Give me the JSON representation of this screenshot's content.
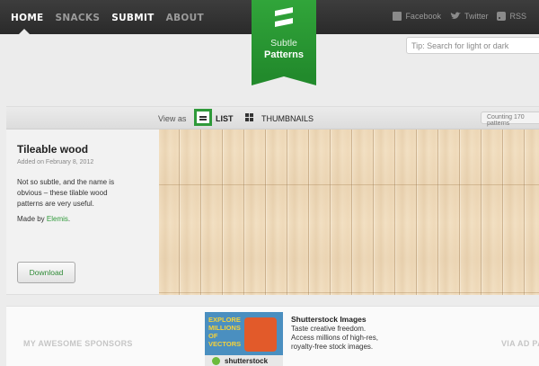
{
  "nav": {
    "items": [
      {
        "label": "HOME",
        "active": true
      },
      {
        "label": "SNACKS",
        "active": false
      },
      {
        "label": "SUBMIT",
        "active": false
      },
      {
        "label": "ABOUT",
        "active": false
      }
    ]
  },
  "social": {
    "facebook": "Facebook",
    "twitter": "Twitter",
    "rss": "RSS"
  },
  "logo": {
    "line1": "Subtle",
    "line2": "Patterns"
  },
  "search": {
    "placeholder": "Tip: Search for light or dark"
  },
  "viewbar": {
    "view_as": "View as",
    "list_label": "LIST",
    "thumbnails_label": "THUMBNAILS",
    "counting": "Counting 170 patterns"
  },
  "pattern": {
    "title": "Tileable wood",
    "added": "Added on February 8, 2012",
    "description": "Not so subtle, and the name is obvious – these tilable wood patterns are very useful.",
    "made_by_prefix": "Made by ",
    "made_by_link": "Elemis",
    "made_by_suffix": ".",
    "download_label": "Download"
  },
  "sponsors": {
    "label": "MY AWESOME SPONSORS",
    "via": "VIA AD PACKS",
    "ad": {
      "image_text": "EXPLORE MILLIONS OF VECTORS",
      "image_brand": "shutterstock",
      "title": "Shutterstock Images",
      "line1": "Taste creative freedom.",
      "line2": "Access millions of high-res,",
      "line3": "royalty-free stock images."
    }
  },
  "colors": {
    "accent": "#2f9a3a",
    "topbar": "#333333"
  }
}
